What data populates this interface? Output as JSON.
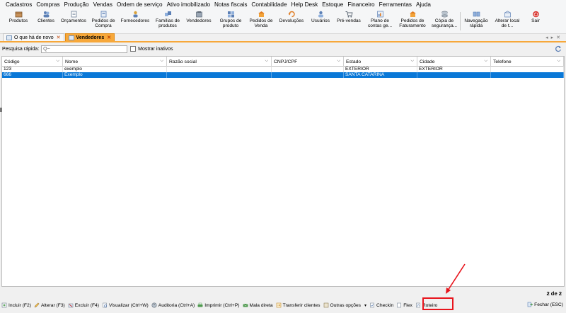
{
  "menu": [
    "Cadastros",
    "Compras",
    "Produção",
    "Vendas",
    "Ordem de serviço",
    "Ativo imobilizado",
    "Notas fiscais",
    "Contabilidade",
    "Help Desk",
    "Estoque",
    "Financeiro",
    "Ferramentas",
    "Ajuda"
  ],
  "toolbar": [
    {
      "label": "Produtos",
      "icon": "box-icon"
    },
    {
      "label": "Clientes",
      "icon": "users-icon"
    },
    {
      "label": "Orçamentos",
      "icon": "quote-icon"
    },
    {
      "label": "Pedidos de\nCompra",
      "icon": "purchase-order-icon"
    },
    {
      "label": "Fornecedores",
      "icon": "supplier-icon"
    },
    {
      "label": "Famílias de\nprodutos",
      "icon": "product-family-icon"
    },
    {
      "label": "Vendedores",
      "icon": "salesperson-icon"
    },
    {
      "label": "Grupos de\nproduto",
      "icon": "product-group-icon"
    },
    {
      "label": "Pedidos de\nVenda",
      "icon": "sales-order-icon"
    },
    {
      "label": "Devoluções",
      "icon": "return-icon"
    },
    {
      "label": "Usuários",
      "icon": "user-icon"
    },
    {
      "label": "Pré-vendas",
      "icon": "cart-icon"
    },
    {
      "label": "Plano de\ncontas ge...",
      "icon": "chart-of-accounts-icon"
    },
    {
      "label": "Pedidos de\nFaturamento",
      "icon": "invoice-order-icon"
    },
    {
      "label": "Cópia de\nsegurança...",
      "icon": "backup-icon"
    },
    {
      "label": "Navegação\nrápida",
      "icon": "quick-nav-icon"
    },
    {
      "label": "Alterar local\nde t...",
      "icon": "location-icon"
    },
    {
      "label": "Sair",
      "icon": "power-icon"
    }
  ],
  "tabs": [
    {
      "label": "O que há de novo",
      "active": false
    },
    {
      "label": "Vendedores",
      "active": true
    }
  ],
  "search": {
    "label": "Pesquisa rápida:",
    "placeholder": "Q~",
    "show_inactive": "Mostrar inativos"
  },
  "grid": {
    "columns": [
      "Código",
      "Nome",
      "Razão social",
      "CNPJ/CPF",
      "Estado",
      "Cidade",
      "Telefone"
    ],
    "rows": [
      [
        "123",
        "exemplo",
        "",
        "",
        "EXTERIOR",
        "EXTERIOR",
        ""
      ],
      [
        "666",
        "Exemplo",
        "",
        "",
        "SANTA CATARINA",
        "",
        ""
      ]
    ],
    "selected_row": 1
  },
  "pager": "2 de 2",
  "bottom": {
    "buttons": [
      "Incluir (F2)",
      "Alterar (F3)",
      "Excluir (F4)",
      "Visualizar (Ctrl+W)",
      "Auditoria (Ctrl+A)",
      "Imprimir (Ctrl+P)",
      "Mala direta",
      "Transferir clientes",
      "Outras opções",
      "Checkin",
      "Flex",
      "Roteiro"
    ],
    "close": "Fechar (ESC)"
  },
  "colors": {
    "accent": "#f7a83a",
    "selection": "#0a78d7",
    "highlight": "#e8141c"
  }
}
